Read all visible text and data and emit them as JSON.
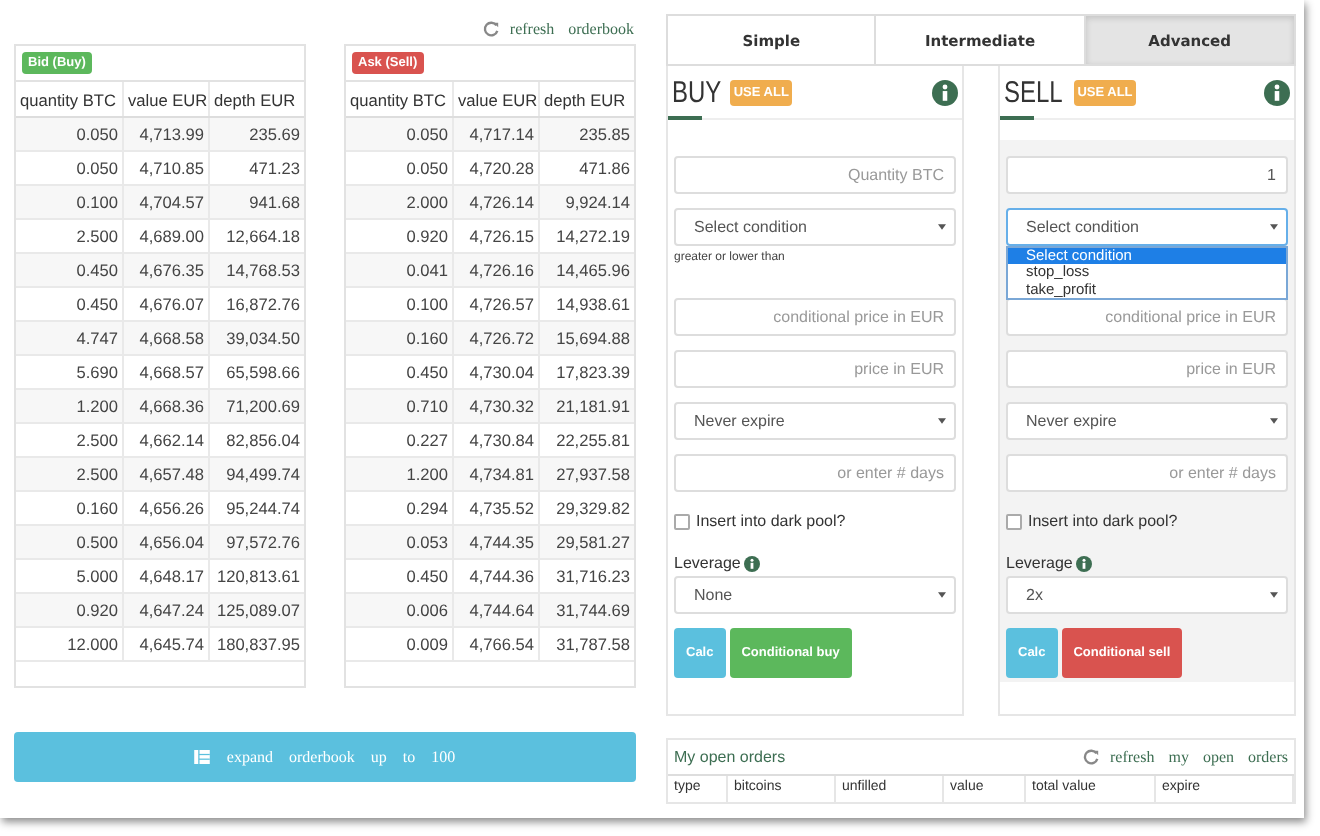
{
  "orderbook": {
    "refresh_link": "refresh orderbook",
    "bid": {
      "badge": "Bid (Buy)",
      "kind": "bid",
      "columns": [
        "quantity BTC",
        "value EUR",
        "depth EUR"
      ],
      "rows": [
        [
          "0.050",
          "4,713.99",
          "235.69"
        ],
        [
          "0.050",
          "4,710.85",
          "471.23"
        ],
        [
          "0.100",
          "4,704.57",
          "941.68"
        ],
        [
          "2.500",
          "4,689.00",
          "12,664.18"
        ],
        [
          "0.450",
          "4,676.35",
          "14,768.53"
        ],
        [
          "0.450",
          "4,676.07",
          "16,872.76"
        ],
        [
          "4.747",
          "4,668.58",
          "39,034.50"
        ],
        [
          "5.690",
          "4,668.57",
          "65,598.66"
        ],
        [
          "1.200",
          "4,668.36",
          "71,200.69"
        ],
        [
          "2.500",
          "4,662.14",
          "82,856.04"
        ],
        [
          "2.500",
          "4,657.48",
          "94,499.74"
        ],
        [
          "0.160",
          "4,656.26",
          "95,244.74"
        ],
        [
          "0.500",
          "4,656.04",
          "97,572.76"
        ],
        [
          "5.000",
          "4,648.17",
          "120,813.61"
        ],
        [
          "0.920",
          "4,647.24",
          "125,089.07"
        ],
        [
          "12.000",
          "4,645.74",
          "180,837.95"
        ]
      ]
    },
    "ask": {
      "badge": "Ask (Sell)",
      "kind": "ask",
      "columns": [
        "quantity BTC",
        "value EUR",
        "depth EUR"
      ],
      "rows": [
        [
          "0.050",
          "4,717.14",
          "235.85"
        ],
        [
          "0.050",
          "4,720.28",
          "471.86"
        ],
        [
          "2.000",
          "4,726.14",
          "9,924.14"
        ],
        [
          "0.920",
          "4,726.15",
          "14,272.19"
        ],
        [
          "0.041",
          "4,726.16",
          "14,465.96"
        ],
        [
          "0.100",
          "4,726.57",
          "14,938.61"
        ],
        [
          "0.160",
          "4,726.72",
          "15,694.88"
        ],
        [
          "0.450",
          "4,730.04",
          "17,823.39"
        ],
        [
          "0.710",
          "4,730.32",
          "21,181.91"
        ],
        [
          "0.227",
          "4,730.84",
          "22,255.81"
        ],
        [
          "1.200",
          "4,734.81",
          "27,937.58"
        ],
        [
          "0.294",
          "4,735.52",
          "29,329.82"
        ],
        [
          "0.053",
          "4,744.35",
          "29,581.27"
        ],
        [
          "0.450",
          "4,744.36",
          "31,716.23"
        ],
        [
          "0.006",
          "4,744.64",
          "31,744.69"
        ],
        [
          "0.009",
          "4,766.54",
          "31,787.58"
        ]
      ]
    },
    "expand_button": "expand orderbook up to 100"
  },
  "mode_tabs": [
    {
      "label": "Simple",
      "selected": false
    },
    {
      "label": "Intermediate",
      "selected": false
    },
    {
      "label": "Advanced",
      "selected": true
    }
  ],
  "forms": [
    {
      "title": "BUY",
      "kind": "buy",
      "use_all": "USE ALL",
      "fields": [
        {
          "kind": "input",
          "placeholder": "Quantity BTC"
        },
        {
          "kind": "select",
          "value": "Select condition",
          "hint": "greater or lower than"
        },
        {
          "kind": "input",
          "placeholder": "conditional price in EUR"
        },
        {
          "kind": "input",
          "placeholder": "price in EUR"
        },
        {
          "kind": "select",
          "value": "Never expire"
        },
        {
          "kind": "input",
          "placeholder": "or enter # days"
        }
      ],
      "dark_pool": {
        "label": "Insert into dark pool?",
        "checked": false
      },
      "leverage": {
        "label": "Leverage",
        "value": "None"
      },
      "buttons": [
        {
          "kind": "calc",
          "label": "Calc"
        },
        {
          "kind": "buy",
          "label": "Conditional buy"
        }
      ]
    },
    {
      "title": "SELL",
      "kind": "sell",
      "use_all": "USE ALL",
      "fields": [
        {
          "kind": "input",
          "value": "1"
        },
        {
          "kind": "select",
          "value": "Select condition",
          "expanded": true,
          "options": [
            {
              "label": "Select condition",
              "selected": true
            },
            {
              "label": "stop_loss",
              "selected": false
            },
            {
              "label": "take_profit",
              "selected": false
            }
          ]
        },
        {
          "kind": "input",
          "placeholder": "conditional price in EUR"
        },
        {
          "kind": "input",
          "placeholder": "price in EUR"
        },
        {
          "kind": "select",
          "value": "Never expire"
        },
        {
          "kind": "input",
          "placeholder": "or enter # days"
        }
      ],
      "dark_pool": {
        "label": "Insert into dark pool?",
        "checked": false
      },
      "leverage": {
        "label": "Leverage",
        "value": "2x"
      },
      "buttons": [
        {
          "kind": "calc",
          "label": "Calc"
        },
        {
          "kind": "sell",
          "label": "Conditional sell"
        }
      ]
    }
  ],
  "open_orders": {
    "title": "My open orders",
    "refresh_link": "refresh my open orders",
    "columns": [
      "type",
      "bitcoins",
      "unfilled",
      "value",
      "total value",
      "expire"
    ]
  }
}
